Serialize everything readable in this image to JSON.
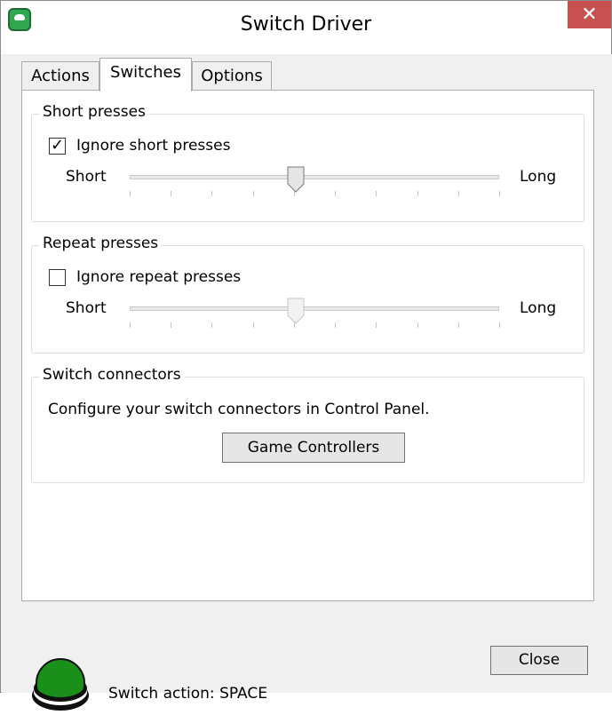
{
  "window": {
    "title": "Switch Driver",
    "close_glyph": "✕"
  },
  "tabs": [
    {
      "label": "Actions",
      "active": false
    },
    {
      "label": "Switches",
      "active": true
    },
    {
      "label": "Options",
      "active": false
    }
  ],
  "short_presses": {
    "group_title": "Short presses",
    "checkbox_label": "Ignore short presses",
    "checked": true,
    "slider": {
      "min_label": "Short",
      "max_label": "Long",
      "value_fraction": 0.45,
      "enabled": true,
      "tick_count": 10
    }
  },
  "repeat_presses": {
    "group_title": "Repeat presses",
    "checkbox_label": "Ignore repeat presses",
    "checked": false,
    "slider": {
      "min_label": "Short",
      "max_label": "Long",
      "value_fraction": 0.45,
      "enabled": false,
      "tick_count": 10
    }
  },
  "switch_connectors": {
    "group_title": "Switch connectors",
    "description": "Configure your switch connectors in Control Panel.",
    "button_label": "Game Controllers"
  },
  "footer": {
    "status": "Switch action: SPACE",
    "close_label": "Close",
    "switch_color": "#1a8f1a"
  },
  "colors": {
    "accent": "#2fa84f",
    "close_button": "#c75050"
  }
}
